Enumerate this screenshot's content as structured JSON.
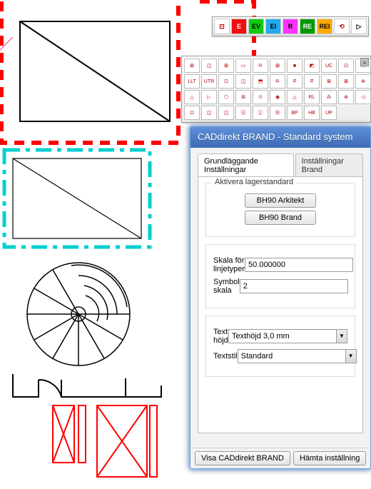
{
  "dialog": {
    "title": "CADdirekt BRAND - Standard system",
    "tabs": {
      "basic": "Grundläggande Inställningar",
      "brand": "Inställningar Brand"
    },
    "group_title": "Aktivera lagerstandard",
    "buttons": {
      "bh90_ark": "BH90 Arkitekt",
      "bh90_brand": "BH90 Brand"
    },
    "labels": {
      "line_scale": "Skala för linjetyper",
      "symbol_scale": "Symbol skala",
      "text_height": "Text höjd",
      "text_style": "Textstil"
    },
    "values": {
      "line_scale": "50.000000",
      "symbol_scale": "2",
      "text_height": "Texthöjd 3,0 mm",
      "text_style": "Standard"
    },
    "footer": {
      "show": "Visa CADdirekt BRAND",
      "fetch": "Hämta inställning"
    }
  },
  "toolbar1": {
    "items": [
      {
        "t": "⊡",
        "bg": "#fff",
        "c": "#b00"
      },
      {
        "t": "E",
        "bg": "#e11",
        "c": "#fff"
      },
      {
        "t": "EV",
        "bg": "#1c1",
        "c": "#000"
      },
      {
        "t": "EI",
        "bg": "#2ae",
        "c": "#000"
      },
      {
        "t": "R",
        "bg": "#f3f",
        "c": "#000"
      },
      {
        "t": "RE",
        "bg": "#090",
        "c": "#fff"
      },
      {
        "t": "REI",
        "bg": "#fa0",
        "c": "#000"
      },
      {
        "t": "⟲",
        "bg": "#fff",
        "c": "#b00"
      },
      {
        "t": "▷",
        "bg": "#fff",
        "c": "#000"
      }
    ]
  },
  "palette_rows": [
    [
      "⊠",
      "◫",
      "⊠",
      "▭",
      "⧅",
      "⊠",
      "■",
      "◩",
      "UC",
      "⊡",
      "ⓘ"
    ],
    [
      "LLT",
      "UTR",
      "⊡",
      "◫",
      "⬒",
      "⧅",
      "⧄",
      "⧄",
      "⊠",
      "⊠",
      "⊗"
    ],
    [
      "△",
      "▷",
      "⬡",
      "⊞",
      "⊙",
      "◉",
      "△",
      "RL",
      "⁂",
      "⊗",
      "◁"
    ],
    [
      "⊡",
      "◫",
      "◫",
      "Ⓤ",
      "Ⓛ",
      "Ⓝ",
      "BP",
      "HB",
      "UP",
      "",
      ""
    ]
  ]
}
